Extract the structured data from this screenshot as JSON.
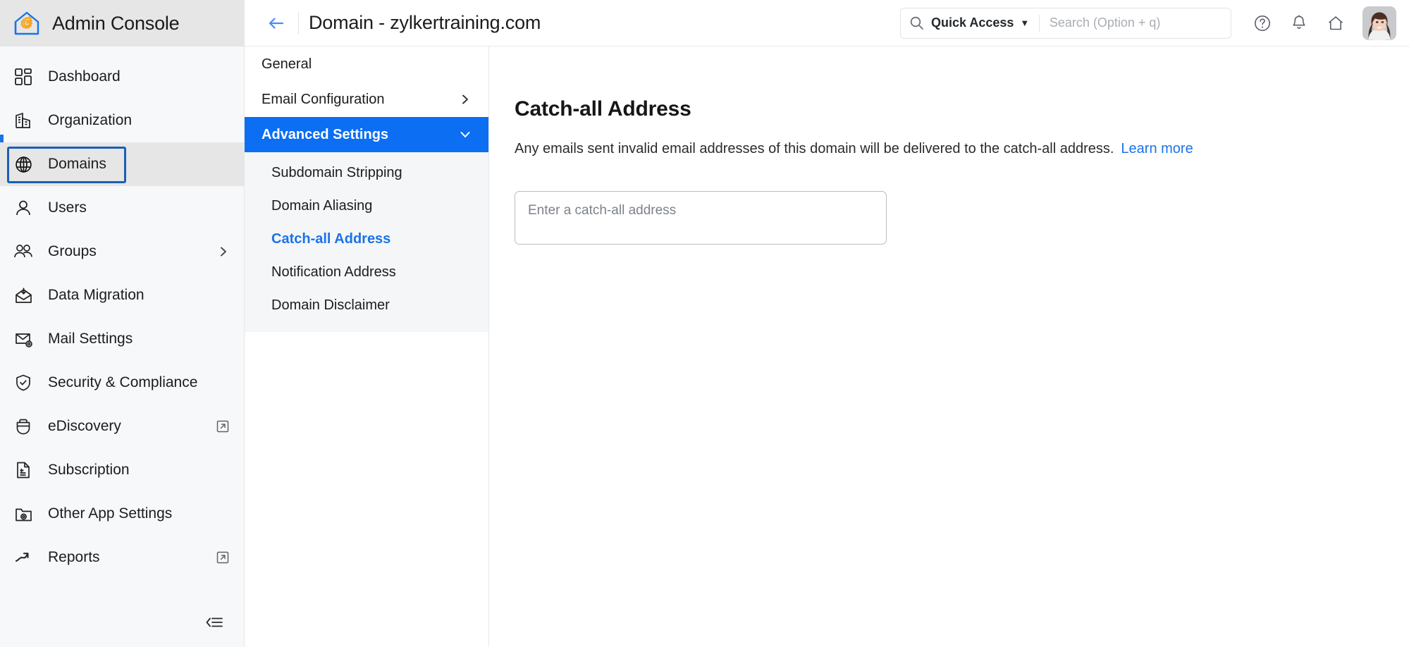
{
  "brand": {
    "title": "Admin Console",
    "logo_icon": "house-gear-icon"
  },
  "sidebar": {
    "items": [
      {
        "label": "Dashboard",
        "icon": "dashboard-grid-icon",
        "trailing": "",
        "state": "default"
      },
      {
        "label": "Organization",
        "icon": "building-icon",
        "trailing": "",
        "state": "default"
      },
      {
        "label": "Domains",
        "icon": "globe-icon",
        "trailing": "",
        "state": "active"
      },
      {
        "label": "Users",
        "icon": "user-icon",
        "trailing": "",
        "state": "default"
      },
      {
        "label": "Groups",
        "icon": "users-group-icon",
        "trailing": "chevron-right-icon",
        "state": "default"
      },
      {
        "label": "Data Migration",
        "icon": "mail-download-icon",
        "trailing": "",
        "state": "default"
      },
      {
        "label": "Mail Settings",
        "icon": "mail-gear-icon",
        "trailing": "",
        "state": "default"
      },
      {
        "label": "Security & Compliance",
        "icon": "shield-check-icon",
        "trailing": "",
        "state": "default"
      },
      {
        "label": "eDiscovery",
        "icon": "briefcase-icon",
        "trailing": "external-link-icon",
        "state": "default"
      },
      {
        "label": "Subscription",
        "icon": "invoice-icon",
        "trailing": "",
        "state": "default"
      },
      {
        "label": "Other App Settings",
        "icon": "folder-gear-icon",
        "trailing": "",
        "state": "default"
      },
      {
        "label": "Reports",
        "icon": "trend-up-icon",
        "trailing": "external-link-icon",
        "state": "default"
      }
    ],
    "collapse_icon": "collapse-sidebar-icon"
  },
  "topbar": {
    "back_icon": "back-arrow-icon",
    "title": "Domain - zylkertraining.com",
    "quick_access_label": "Quick Access",
    "quick_access_caret": "▼",
    "search_icon": "search-icon",
    "search_value": "",
    "search_placeholder": "Search (Option + q)",
    "help_icon": "help-circle-icon",
    "notification_icon": "bell-icon",
    "home_icon": "home-icon",
    "avatar_icon": "avatar"
  },
  "midnav": {
    "items": [
      {
        "label": "General",
        "trailing": "",
        "state": "default"
      },
      {
        "label": "Email Configuration",
        "trailing": "chevron-right-icon",
        "state": "default"
      },
      {
        "label": "Advanced Settings",
        "trailing": "chevron-down-icon",
        "state": "selected"
      }
    ],
    "sub_items": [
      {
        "label": "Subdomain Stripping",
        "state": "default"
      },
      {
        "label": "Domain Aliasing",
        "state": "default"
      },
      {
        "label": "Catch-all Address",
        "state": "current"
      },
      {
        "label": "Notification Address",
        "state": "default"
      },
      {
        "label": "Domain Disclaimer",
        "state": "default"
      }
    ]
  },
  "main": {
    "title": "Catch-all Address",
    "description": "Any emails sent invalid email addresses of this domain will be delivered to the catch-all address.",
    "learn_more": "Learn more",
    "input_value": "",
    "input_placeholder": "Enter a catch-all address"
  },
  "colors": {
    "accent_blue": "#1a73e8",
    "selected_blue": "#0b6ef3",
    "focus_ring": "#1a5fb4",
    "sidebar_bg": "#f7f8fa",
    "brand_bg": "#e6e6e6",
    "logo_blue": "#1a73e8",
    "logo_orange": "#f5a623"
  }
}
